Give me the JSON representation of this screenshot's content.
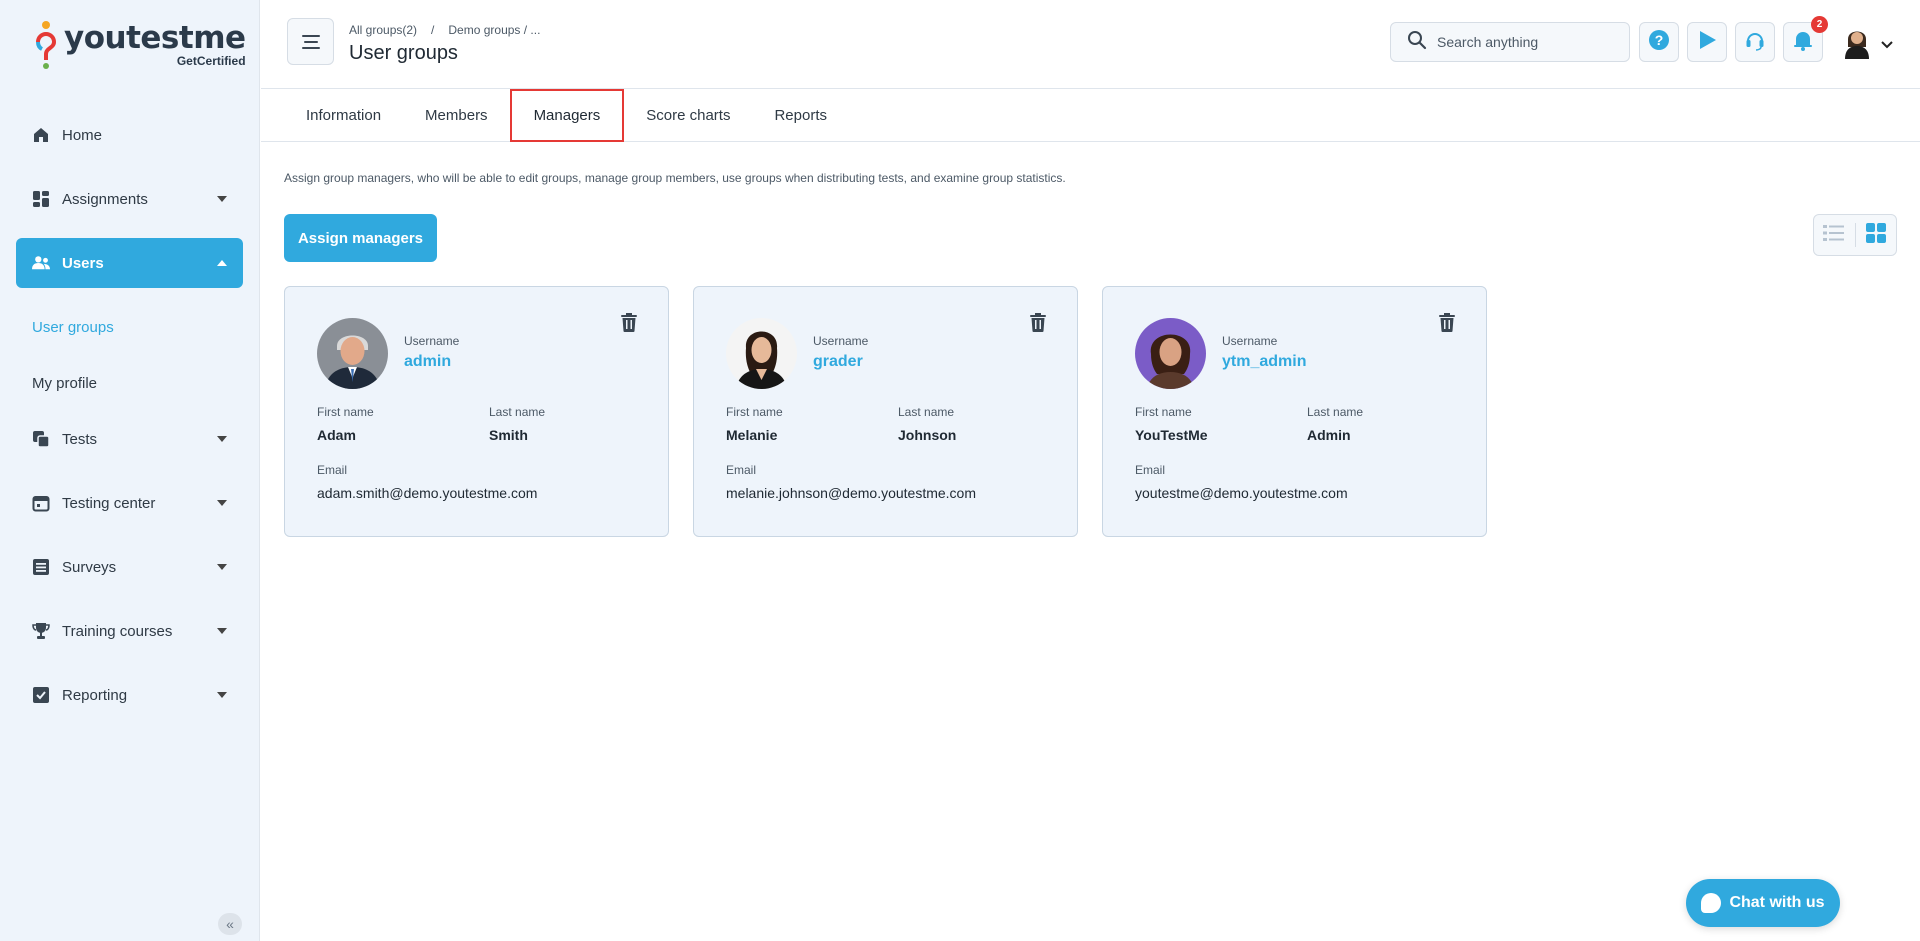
{
  "logo": {
    "word_a": "you",
    "word_b": "testme",
    "sub": "GetCertified"
  },
  "sidebar": {
    "items": [
      {
        "label": "Home",
        "icon": "home-icon"
      },
      {
        "label": "Assignments",
        "icon": "dashboard-icon"
      },
      {
        "label": "Users",
        "icon": "users-icon"
      },
      {
        "label": "Tests",
        "icon": "copy-icon"
      },
      {
        "label": "Testing center",
        "icon": "calendar-icon"
      },
      {
        "label": "Surveys",
        "icon": "list-icon"
      },
      {
        "label": "Training courses",
        "icon": "trophy-icon"
      },
      {
        "label": "Reporting",
        "icon": "report-icon"
      }
    ],
    "sub_items": [
      {
        "label": "User groups"
      },
      {
        "label": "My profile"
      }
    ]
  },
  "header": {
    "breadcrumb": [
      "All groups(2)",
      "/",
      "Demo groups / ..."
    ],
    "title": "User groups",
    "search_placeholder": "Search anything",
    "notifications_count": "2"
  },
  "tabs": [
    "Information",
    "Members",
    "Managers",
    "Score charts",
    "Reports"
  ],
  "active_tab": "Managers",
  "description": "Assign group managers, who will be able to edit groups, manage group members, use groups when distributing tests, and examine group statistics.",
  "assign_button": "Assign managers",
  "labels": {
    "username": "Username",
    "first_name": "First name",
    "last_name": "Last name",
    "email": "Email"
  },
  "managers": [
    {
      "username": "admin",
      "first_name": "Adam",
      "last_name": "Smith",
      "email": "adam.smith@demo.youtestme.com"
    },
    {
      "username": "grader",
      "first_name": "Melanie",
      "last_name": "Johnson",
      "email": "melanie.johnson@demo.youtestme.com"
    },
    {
      "username": "ytm_admin",
      "first_name": "YouTestMe",
      "last_name": "Admin",
      "email": "youtestme@demo.youtestme.com"
    }
  ],
  "chat_label": "Chat with us",
  "colors": {
    "accent": "#30a9de",
    "sidebar_bg": "#eef4fb",
    "highlight": "#e53935"
  }
}
